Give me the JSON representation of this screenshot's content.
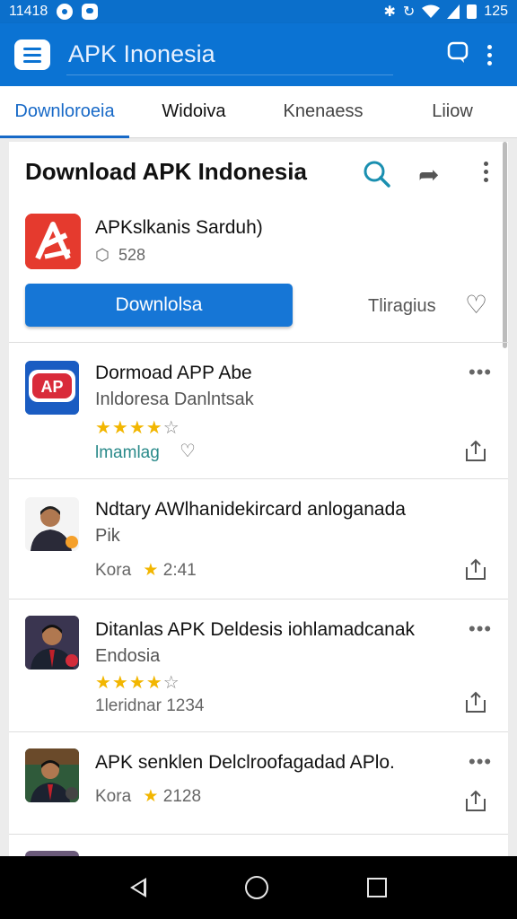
{
  "status_bar": {
    "time": "11418",
    "battery": "125"
  },
  "app_bar": {
    "title": "APK Inonesia",
    "menu_icon": "menu-icon",
    "chat_icon": "chat-icon",
    "more_icon": "more-vert-icon"
  },
  "tabs": [
    {
      "label": "Downloroeia"
    },
    {
      "label": "Widoiva"
    },
    {
      "label": "Knenaess"
    },
    {
      "label": "Liiow"
    }
  ],
  "hero": {
    "heading": "Download APK Indonesia",
    "app_name": "APKslkanis Sarduh)",
    "size": "528",
    "download_label": "Downlolsa",
    "secondary_label": "Tliragius"
  },
  "items": [
    {
      "title": "Dormoad APP Abe",
      "subtitle": "Inldoresa Danlntsak",
      "rating_filled": "★★★★",
      "rating_empty": "☆",
      "meta": "lmamlag",
      "more": "•••"
    },
    {
      "title": "Ndtary AWlhanidekircard anloganada",
      "subtitle": "Pik",
      "meta_label": "Kora",
      "star": "★",
      "meta_value": "2:41"
    },
    {
      "title": "Ditanlas APK Deldesis iohlamadcanak",
      "subtitle": "Endosia",
      "rating_filled": "★★★★",
      "rating_empty": "☆",
      "meta": "1leridnar 1234",
      "more": "•••"
    },
    {
      "title": "APK senklen Delclroofagadad APlo.",
      "meta_label": "Kora",
      "star": "★",
      "meta_value": "2128",
      "more": "•••"
    }
  ],
  "colors": {
    "primary": "#0b73d3",
    "accent_tab": "#1769c7",
    "button": "#1676d6",
    "star": "#f2b600",
    "logo_red": "#e53a2e"
  }
}
